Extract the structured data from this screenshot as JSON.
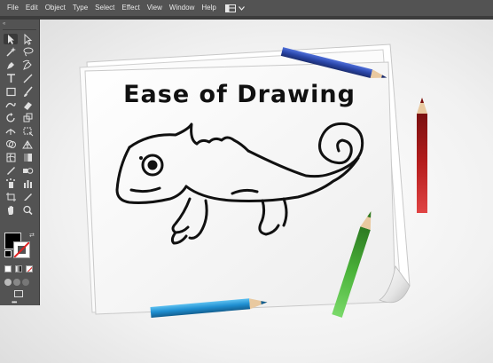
{
  "menu": {
    "items": [
      "File",
      "Edit",
      "Object",
      "Type",
      "Select",
      "Effect",
      "View",
      "Window",
      "Help"
    ]
  },
  "workspace_switcher": {
    "icon": "workspace-layout-icon"
  },
  "tools_panel": {
    "collapse_marks": "«",
    "tools": [
      "selection-tool-icon",
      "direct-selection-tool-icon",
      "magic-wand-tool-icon",
      "lasso-tool-icon",
      "pen-tool-icon",
      "curvature-tool-icon",
      "type-tool-icon",
      "line-segment-tool-icon",
      "rectangle-tool-icon",
      "paintbrush-tool-icon",
      "shaper-tool-icon",
      "eraser-tool-icon",
      "rotate-tool-icon",
      "scale-tool-icon",
      "width-tool-icon",
      "free-transform-tool-icon",
      "shape-builder-tool-icon",
      "perspective-grid-tool-icon",
      "mesh-tool-icon",
      "gradient-tool-icon",
      "eyedropper-tool-icon",
      "blend-tool-icon",
      "symbol-sprayer-tool-icon",
      "column-graph-tool-icon",
      "artboard-tool-icon",
      "slice-tool-icon",
      "hand-tool-icon",
      "zoom-tool-icon"
    ],
    "fill_color": "#000000",
    "stroke_color": "none",
    "more_tools": "•••"
  },
  "canvas": {
    "title": "Ease of Drawing",
    "colors": {
      "blue_pencil": "#2a46a8",
      "cyan_pencil": "#1f8fd1",
      "red_pencil": "#b51d1d",
      "green_pencil": "#4bb33a",
      "paper": "#ffffff"
    },
    "illustration": "chameleon-line-drawing"
  }
}
